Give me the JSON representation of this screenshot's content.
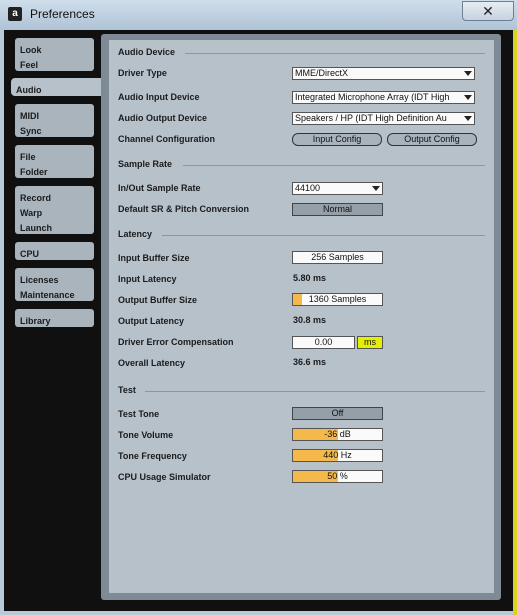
{
  "window": {
    "title": "Preferences",
    "close_symbol": "✕",
    "icon": "ableton-icon"
  },
  "tabs": [
    {
      "lines": [
        "Look",
        "Feel"
      ],
      "active": false
    },
    {
      "lines": [
        "Audio"
      ],
      "active": true
    },
    {
      "lines": [
        "MIDI",
        "Sync"
      ],
      "active": false
    },
    {
      "lines": [
        "File",
        "Folder"
      ],
      "active": false
    },
    {
      "lines": [
        "Record",
        "Warp",
        "Launch"
      ],
      "active": false
    },
    {
      "lines": [
        "CPU"
      ],
      "active": false
    },
    {
      "lines": [
        "Licenses",
        "Maintenance"
      ],
      "active": false
    },
    {
      "lines": [
        "Library"
      ],
      "active": false
    }
  ],
  "audio_device": {
    "heading": "Audio Device",
    "driver_type_label": "Driver Type",
    "driver_type_value": "MME/DirectX",
    "input_device_label": "Audio Input Device",
    "input_device_value": "Integrated Microphone Array (IDT High",
    "output_device_label": "Audio Output Device",
    "output_device_value": "Speakers / HP (IDT High Definition Au",
    "channel_config_label": "Channel Configuration",
    "input_config_button": "Input Config",
    "output_config_button": "Output Config"
  },
  "sample_rate": {
    "heading": "Sample Rate",
    "in_out_label": "In/Out Sample Rate",
    "in_out_value": "44100",
    "default_sr_label": "Default SR & Pitch Conversion",
    "default_sr_value": "Normal"
  },
  "latency": {
    "heading": "Latency",
    "input_buffer_label": "Input Buffer Size",
    "input_buffer_value": "256 Samples",
    "input_latency_label": "Input Latency",
    "input_latency_value": "5.80 ms",
    "output_buffer_label": "Output Buffer Size",
    "output_buffer_value": "1360 Samples",
    "output_buffer_fill": 0.1,
    "output_latency_label": "Output Latency",
    "output_latency_value": "30.8 ms",
    "driver_error_label": "Driver Error Compensation",
    "driver_error_value": "0.00",
    "driver_error_unit": "ms",
    "overall_latency_label": "Overall Latency",
    "overall_latency_value": "36.6 ms"
  },
  "test": {
    "heading": "Test",
    "test_tone_label": "Test Tone",
    "test_tone_value": "Off",
    "tone_volume_label": "Tone Volume",
    "tone_volume_value": "-36 dB",
    "tone_volume_fill": 0.5,
    "tone_frequency_label": "Tone Frequency",
    "tone_frequency_value": "440 Hz",
    "tone_frequency_fill": 0.5,
    "cpu_sim_label": "CPU Usage Simulator",
    "cpu_sim_value": "50 %",
    "cpu_sim_fill": 0.5
  },
  "colors": {
    "accent_orange": "#f5b84a",
    "unit_yellow": "#e5f000",
    "panel_bg": "#b7c1ca"
  }
}
